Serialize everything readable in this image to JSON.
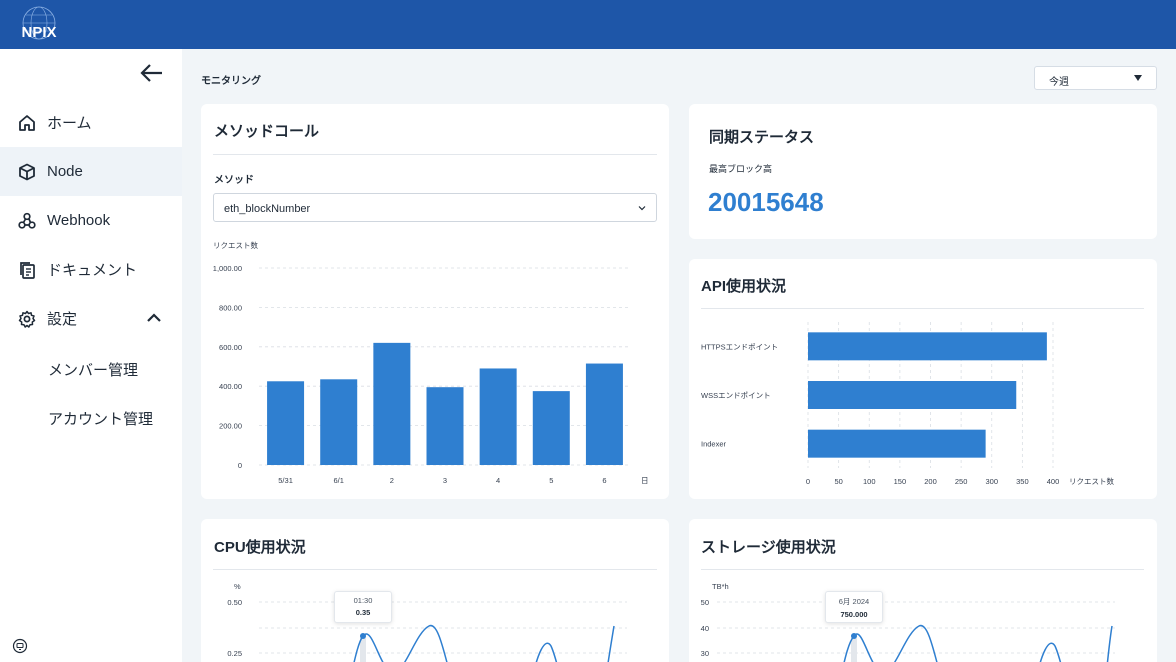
{
  "app": {
    "logo_text": "NPIX"
  },
  "sidebar": {
    "items": [
      {
        "label": "ホーム",
        "icon": "home-icon"
      },
      {
        "label": "Node",
        "icon": "cube-icon"
      },
      {
        "label": "Webhook",
        "icon": "webhook-icon"
      },
      {
        "label": "ドキュメント",
        "icon": "document-icon"
      },
      {
        "label": "設定",
        "icon": "gear-icon"
      }
    ],
    "sub_items": [
      {
        "label": "メンバー管理"
      },
      {
        "label": "アカウント管理"
      }
    ],
    "active_item": "Node"
  },
  "header": {
    "page_title": "モニタリング",
    "period": "今週"
  },
  "method_call": {
    "title": "メソッドコール",
    "method_label": "メソッド",
    "method_value": "eth_blockNumber",
    "chart_data": {
      "type": "bar",
      "ylabel": "リクエスト数",
      "xlabel": "日",
      "categories": [
        "5/31",
        "6/1",
        "2",
        "3",
        "4",
        "5",
        "6"
      ],
      "values": [
        425,
        435,
        620,
        395,
        490,
        375,
        515
      ],
      "ylim": [
        0,
        1000
      ],
      "yticks": [
        "1,000.00",
        "800.00",
        "600.00",
        "400.00",
        "200.00",
        "0"
      ],
      "grid": true
    }
  },
  "sync_status": {
    "title": "同期ステータス",
    "label": "最高ブロック高",
    "value": "20015648"
  },
  "api_usage": {
    "title": "API使用状況",
    "chart_data": {
      "type": "bar",
      "orientation": "horizontal",
      "categories": [
        "HTTPSエンドポイント",
        "WSSエンドポイント",
        "Indexer"
      ],
      "values": [
        390,
        340,
        290
      ],
      "xlim": [
        0,
        400
      ],
      "xticks": [
        "0",
        "50",
        "100",
        "150",
        "200",
        "250",
        "300",
        "350",
        "400"
      ],
      "xlabel": "リクエスト数",
      "grid": true
    }
  },
  "cpu_usage": {
    "title": "CPU使用状況",
    "tooltip": {
      "label": "01:30",
      "value": "0.35"
    },
    "chart_data": {
      "type": "line",
      "ylabel": "%",
      "yticks": [
        "0.50",
        "0.25"
      ],
      "highlight": {
        "x": "01:30",
        "y": 0.35
      }
    }
  },
  "storage_usage": {
    "title": "ストレージ使用状況",
    "tooltip": {
      "label": "6月 2024",
      "value": "750.000"
    },
    "chart_data": {
      "type": "line",
      "ylabel": "TB*h",
      "yticks": [
        "50",
        "40",
        "30"
      ],
      "highlight": {
        "x": "6月 2024",
        "y": 750
      }
    }
  },
  "colors": {
    "brand": "#1e56a8",
    "accent": "#2f7fd0",
    "bar": "#2f7fd0"
  }
}
